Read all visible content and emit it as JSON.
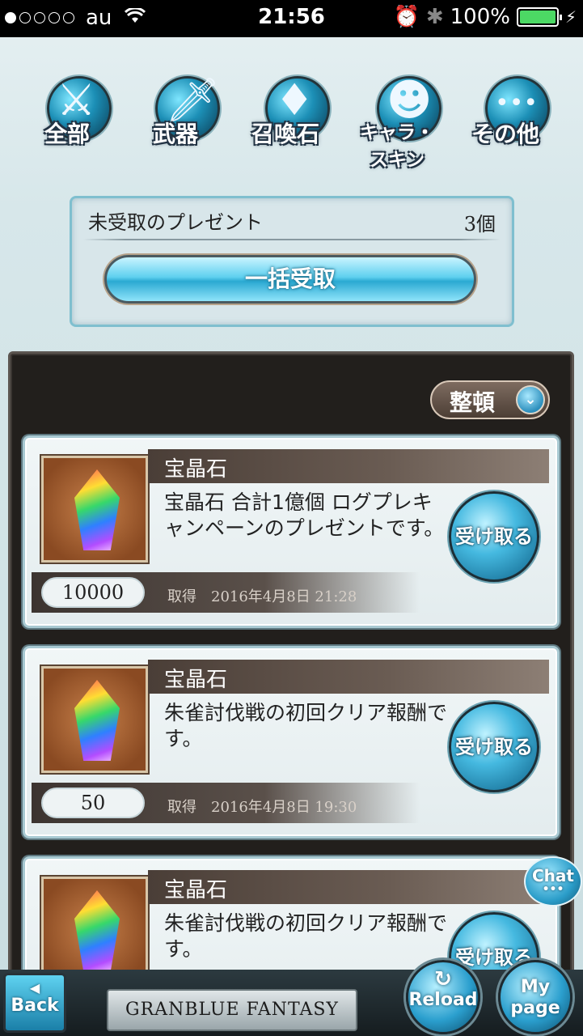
{
  "status_bar": {
    "carrier": "au",
    "time": "21:56",
    "battery_percent": "100%",
    "signal_dots_filled": 1,
    "signal_dots_total": 5
  },
  "categories": [
    {
      "label": "全部",
      "icon": "all-items-icon"
    },
    {
      "label": "武器",
      "icon": "sword-icon"
    },
    {
      "label": "召喚石",
      "icon": "crystal-icon"
    },
    {
      "label": "キャラ・スキン",
      "icon": "character-icon"
    },
    {
      "label": "その他",
      "icon": "more-icon"
    }
  ],
  "summary": {
    "title": "未受取のプレゼント",
    "count": "3個",
    "bulk_button_label": "一括受取"
  },
  "sort_button_label": "整頓",
  "presents": [
    {
      "name": "宝晶石",
      "description": "宝晶石 合計1億個 ログプレキャンペーンのプレゼントです。",
      "quantity": "10000",
      "date": "取得　2016年4月8日 21:28",
      "button_label": "受け取る"
    },
    {
      "name": "宝晶石",
      "description": "朱雀討伐戦の初回クリア報酬です。",
      "quantity": "50",
      "date": "取得　2016年4月8日 19:30",
      "button_label": "受け取る"
    },
    {
      "name": "宝晶石",
      "description": "朱雀討伐戦の初回クリア報酬です。",
      "quantity": "",
      "date": "",
      "button_label": "受け取る"
    }
  ],
  "chat_label": "Chat",
  "nav": {
    "back_label": "Back",
    "logo_text": "GRANBLUE FANTASY",
    "reload_label": "Reload",
    "mypage_label": "My page"
  }
}
